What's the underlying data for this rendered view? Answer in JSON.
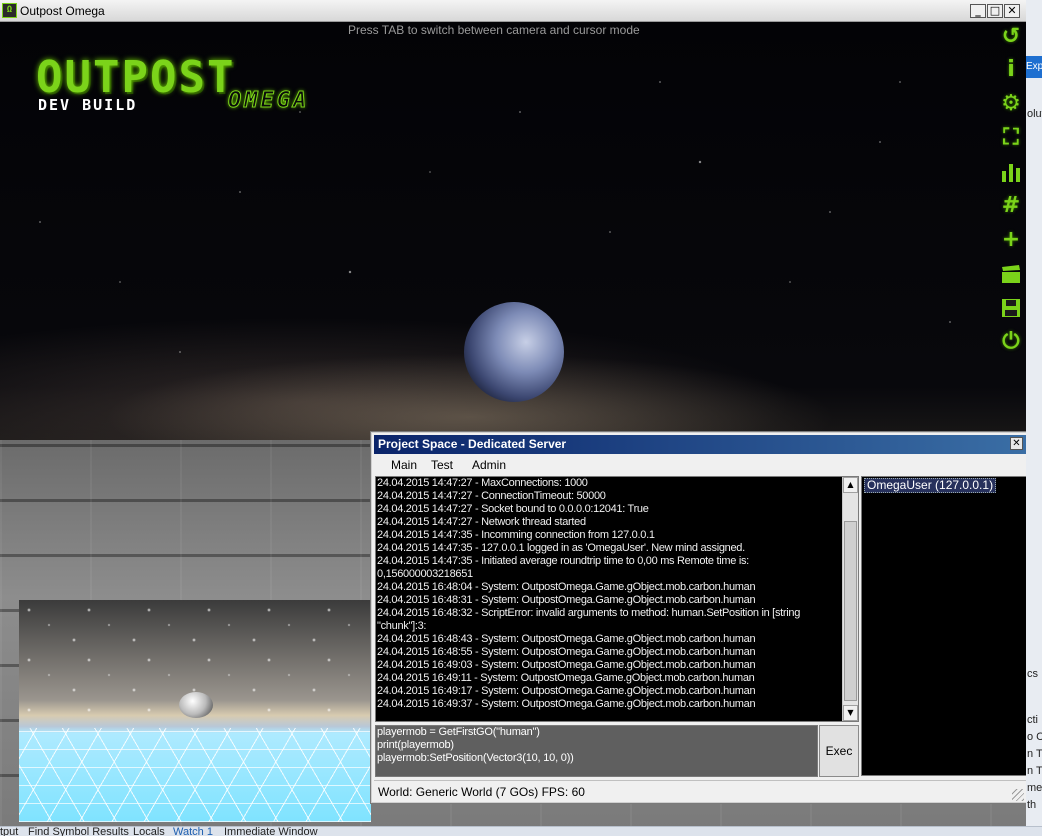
{
  "window": {
    "title": "Outpost Omega",
    "controls": {
      "minimize": "_",
      "maximize": "□",
      "close": "✕"
    }
  },
  "scene": {
    "hint": "Press TAB to switch between camera and cursor mode",
    "logo": {
      "main": "OUTPOST",
      "sub": "DEV BUILD",
      "accent": "OMEGA"
    },
    "accent_color": "#7bd31a"
  },
  "toolbar": {
    "icons": [
      {
        "name": "undo-icon",
        "glyph": "↺"
      },
      {
        "name": "info-icon",
        "glyph": "i"
      },
      {
        "name": "gear-icon",
        "glyph": "⚙"
      },
      {
        "name": "fullscreen-icon",
        "glyph": "⛶"
      },
      {
        "name": "bar-chart-icon",
        "glyph": "▮"
      },
      {
        "name": "hash-icon",
        "glyph": "#"
      },
      {
        "name": "plus-icon",
        "glyph": "+"
      },
      {
        "name": "clapperboard-icon",
        "glyph": "🎬"
      },
      {
        "name": "save-icon",
        "glyph": "💾"
      },
      {
        "name": "power-icon",
        "glyph": "⏻"
      }
    ]
  },
  "dialog": {
    "title": "Project Space - Dedicated Server",
    "close": "✕",
    "menu": [
      "Main",
      "Test",
      "Admin"
    ],
    "log": [
      "24.04.2015 14:47:27 - MaxConnections: 1000",
      "24.04.2015 14:47:27 - ConnectionTimeout: 50000",
      "24.04.2015 14:47:27 - Socket bound to 0.0.0.0:12041: True",
      "24.04.2015 14:47:27 - Network thread started",
      "24.04.2015 14:47:35 - Incomming connection from 127.0.0.1",
      "24.04.2015 14:47:35 - 127.0.0.1 logged in as 'OmegaUser'. New mind assigned.",
      "24.04.2015 14:47:35 - Initiated average roundtrip time to 0,00 ms Remote time is:",
      "0,156000003218651",
      "24.04.2015 16:48:04 - System: OutpostOmega.Game.gObject.mob.carbon.human",
      "24.04.2015 16:48:31 - System: OutpostOmega.Game.gObject.mob.carbon.human",
      "24.04.2015 16:48:32 - ScriptError: invalid arguments to method: human.SetPosition in [string",
      "\"chunk\"]:3:",
      "24.04.2015 16:48:43 - System: OutpostOmega.Game.gObject.mob.carbon.human",
      "24.04.2015 16:48:55 - System: OutpostOmega.Game.gObject.mob.carbon.human",
      "24.04.2015 16:49:03 - System: OutpostOmega.Game.gObject.mob.carbon.human",
      "24.04.2015 16:49:11 - System: OutpostOmega.Game.gObject.mob.carbon.human",
      "24.04.2015 16:49:17 - System: OutpostOmega.Game.gObject.mob.carbon.human",
      "24.04.2015 16:49:37 - System: OutpostOmega.Game.gObject.mob.carbon.human"
    ],
    "users": [
      "OmegaUser (127.0.0.1)"
    ],
    "command": "playermob = GetFirstGO(\"human\")\nprint(playermob)\nplayermob:SetPosition(Vector3(10, 10, 0))",
    "exec_label": "Exec",
    "status": "World: Generic World (7 GOs)   FPS: 60"
  },
  "ide": {
    "side_tab": "Exp",
    "side_fragments": [
      "olut",
      "cs",
      "cti",
      "o C",
      "n T",
      "n T",
      "me",
      "th"
    ],
    "bottom_tabs": [
      "tput",
      "Find Symbol Results",
      "Locals",
      "Watch 1",
      "Immediate Window"
    ]
  }
}
